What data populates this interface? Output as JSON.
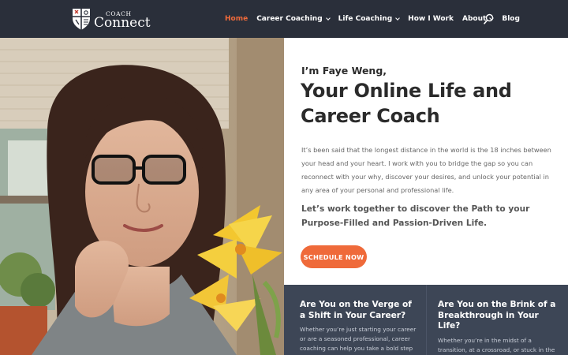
{
  "brand": {
    "small": "COACH",
    "big": "Connect"
  },
  "nav": {
    "items": [
      {
        "label": "Home",
        "active": true,
        "dropdown": false
      },
      {
        "label": "Career Coaching",
        "active": false,
        "dropdown": true
      },
      {
        "label": "Life Coaching",
        "active": false,
        "dropdown": true
      },
      {
        "label": "How I Work",
        "active": false,
        "dropdown": false
      },
      {
        "label": "About",
        "active": false,
        "dropdown": true
      },
      {
        "label": "Blog",
        "active": false,
        "dropdown": false
      }
    ],
    "search_icon": "search-icon"
  },
  "hero": {
    "intro": "I’m Faye Weng,",
    "headline": "Your Online Life and Career Coach",
    "body": "It’s been said that the longest distance in the world is the 18 inches between your head and your heart. I work with you to bridge the gap so you can reconnect with your why, discover your desires, and unlock your potential in any area of your personal and professional life.",
    "cta_text": "Let’s work together to discover the Path to your Purpose-Filled and Passion-Driven Life.",
    "button_label": "SCHEDULE NOW"
  },
  "cards": [
    {
      "title": "Are You on the Verge of a Shift in Your Career?",
      "text": "Whether you’re just starting your career or are a seasoned professional, career coaching can help you take a bold step"
    },
    {
      "title": "Are You on the Brink of a Breakthrough in Your Life?",
      "text": "Whether you’re in the midst of a transition, at a crossroad, or stuck in the cycle of your current situation, life"
    }
  ],
  "colors": {
    "header_bg": "#2a2f3a",
    "accent": "#ef6a3a",
    "cards_bg": "#3d4656"
  }
}
